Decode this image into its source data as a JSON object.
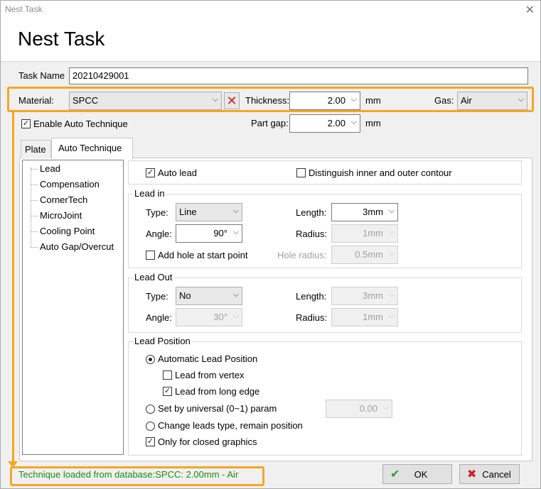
{
  "window": {
    "title": "Nest Task",
    "close_glyph": "✕",
    "heading": "Nest Task"
  },
  "task_name": {
    "label": "Task Name",
    "value": "20210429001"
  },
  "material": {
    "label": "Material:",
    "value": "SPCC",
    "thickness_label": "Thickness:",
    "thickness_value": "2.00",
    "thickness_unit": "mm",
    "gas_label": "Gas:",
    "gas_value": "Air"
  },
  "auto_technique": {
    "label": "Enable Auto Technique",
    "checked": true
  },
  "part_gap": {
    "label": "Part gap:",
    "value": "2.00",
    "unit": "mm"
  },
  "tabs": [
    {
      "label": "Plate"
    },
    {
      "label": "Auto Technique"
    }
  ],
  "tree": [
    "Lead",
    "Compensation",
    "CornerTech",
    "MicroJoint",
    "Cooling Point",
    "Auto Gap/Overcut"
  ],
  "auto_lead": {
    "label": "Auto lead",
    "checked": true
  },
  "distinguish": {
    "label": "Distinguish inner and outer contour",
    "checked": false
  },
  "lead_in": {
    "title": "Lead in",
    "type_label": "Type:",
    "type_value": "Line",
    "length_label": "Length:",
    "length_value": "3mm",
    "angle_label": "Angle:",
    "angle_value": "90°",
    "radius_label": "Radius:",
    "radius_value": "1mm",
    "hole_label": "Add hole at start point",
    "hole_radius_label": "Hole radius:",
    "hole_radius_value": "0.5mm"
  },
  "lead_out": {
    "title": "Lead Out",
    "type_label": "Type:",
    "type_value": "No",
    "length_label": "Length:",
    "length_value": "3mm",
    "angle_label": "Angle:",
    "angle_value": "30°",
    "radius_label": "Radius:",
    "radius_value": "1mm"
  },
  "lead_position": {
    "title": "Lead Position",
    "automatic": "Automatic Lead Position",
    "from_vertex": "Lead from vertex",
    "from_long_edge": "Lead from long edge",
    "universal": "Set by universal (0~1) param",
    "universal_value": "0.00",
    "change_type": "Change leads type, remain position",
    "closed_only": "Only for closed graphics"
  },
  "status_text": "Technique loaded from database:SPCC: 2.00mm - Air",
  "buttons": {
    "ok": "OK",
    "cancel": "Cancel"
  },
  "glyphs": {
    "check": "✓",
    "arrow": "⌵",
    "x": "✕",
    "ok_icon": "✔",
    "cancel_icon": "✖"
  },
  "colors": {
    "highlight": "#f5a623",
    "status_text": "#1a8a1a",
    "red_x": "#d21f1f",
    "ok_icon": "#2aa02a"
  }
}
